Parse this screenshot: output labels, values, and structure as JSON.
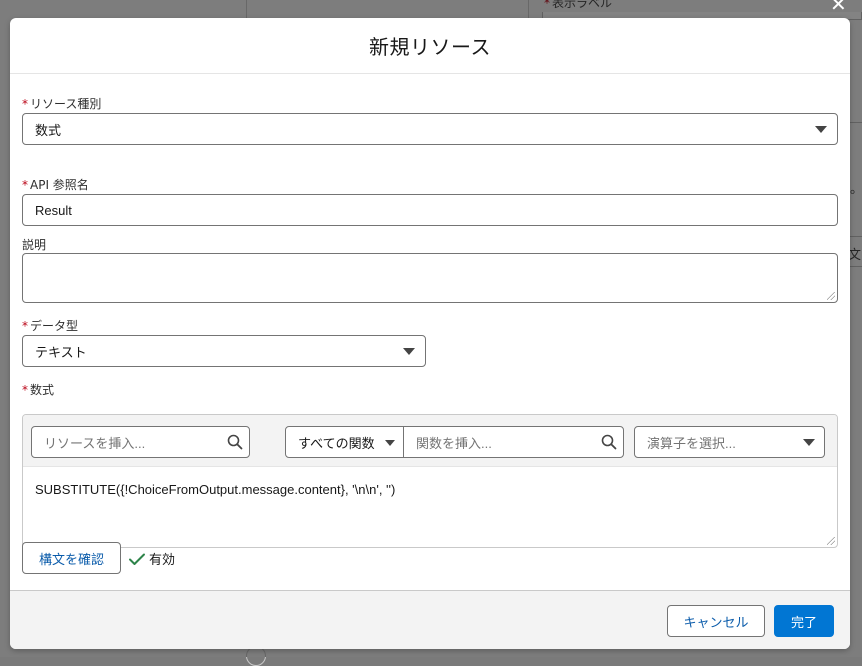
{
  "background": {
    "label": "表示ラベル",
    "side_glyph": "。",
    "side_text": "文"
  },
  "modal": {
    "title": "新規リソース",
    "required_marker": "*",
    "resource_type": {
      "label": "リソース種別",
      "value": "数式"
    },
    "api_name": {
      "label": "API 参照名",
      "value": "Result"
    },
    "description": {
      "label": "説明",
      "value": ""
    },
    "data_type": {
      "label": "データ型",
      "value": "テキスト"
    },
    "formula": {
      "label": "数式",
      "resource_search_placeholder": "リソースを挿入...",
      "function_category": "すべての関数",
      "function_search_placeholder": "関数を挿入...",
      "operator_placeholder": "演算子を選択...",
      "expression": "SUBSTITUTE({!ChoiceFromOutput.message.content}, '\\n\\n', '')"
    },
    "check_syntax_label": "構文を確認",
    "validity_text": "有効",
    "footer": {
      "cancel_label": "キャンセル",
      "done_label": "完了"
    }
  }
}
